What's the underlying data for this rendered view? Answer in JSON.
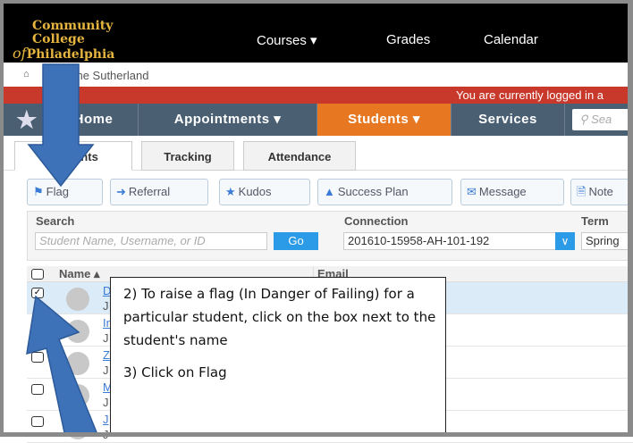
{
  "header": {
    "logo_line1": "Community",
    "logo_line2": "College",
    "logo_of": "of",
    "logo_line3": "Philadelphia",
    "nav": [
      "Courses ▾",
      "Grades",
      "Calendar"
    ]
  },
  "breadcrumb": {
    "name": "Lynne Sutherland"
  },
  "banner": {
    "text": "You are currently logged in a"
  },
  "mainnav": {
    "items": [
      "Home",
      "Appointments ▾",
      "Students ▾",
      "Services"
    ],
    "search_placeholder": "Sea"
  },
  "tabs": [
    "Students",
    "Tracking",
    "Attendance"
  ],
  "actions": [
    "Flag",
    "Referral",
    "Kudos",
    "Success Plan",
    "Message",
    "Note"
  ],
  "search": {
    "label": "Search",
    "placeholder": "Student Name, Username, or ID",
    "go": "Go",
    "connection_label": "Connection",
    "connection_value": "201610-15958-AH-101-192",
    "term_label": "Term",
    "term_value": "Spring"
  },
  "table": {
    "col_name": "Name ▴",
    "col_email": "Email",
    "rows": [
      {
        "link": "D",
        "sub": "J",
        "checked": true
      },
      {
        "link": "In",
        "sub": "J",
        "checked": false
      },
      {
        "link": "Z",
        "sub": "J",
        "checked": false
      },
      {
        "link": "M",
        "sub": "J",
        "checked": false
      },
      {
        "link": "J",
        "sub": "J",
        "checked": false
      }
    ]
  },
  "callout": {
    "step2": "2) To raise a flag (In Danger of Failing) for a particular student, click on the box next to the student's name",
    "step3": "3) Click on Flag"
  },
  "colors": {
    "accent": "#e87722",
    "nav": "#4b5f73",
    "banner": "#c8382b",
    "arrow": "#3e72b8"
  }
}
